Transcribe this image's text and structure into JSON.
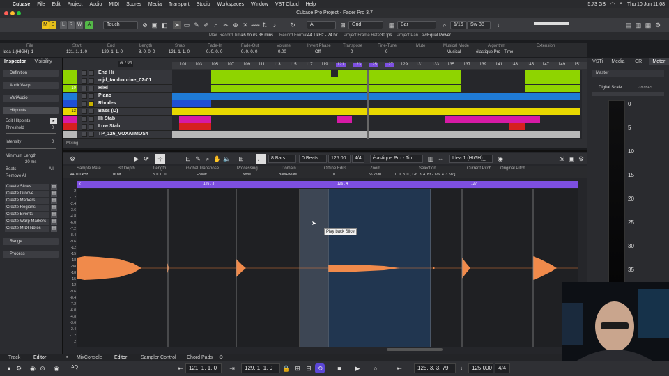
{
  "menubar": {
    "app": "Cubase",
    "items": [
      "File",
      "Edit",
      "Project",
      "Audio",
      "MIDI",
      "Scores",
      "Media",
      "Transport",
      "Studio",
      "Workspaces",
      "Window",
      "VST Cloud",
      "Help"
    ],
    "storage": "5.73 GB",
    "datetime": "Thu 10 Jun  11:08"
  },
  "window": {
    "title": "Cubase Pro Project - Fader Pro 3.7"
  },
  "toolbar": {
    "m": "M",
    "s": "S",
    "l": "L",
    "r": "R",
    "w": "W",
    "a": "A",
    "automation_mode": "Touch",
    "grid_type": "Grid",
    "grid_value": "Bar",
    "quantize": "1/16",
    "swing": "Sw-38",
    "snap_label": "A"
  },
  "status": {
    "max_rec_label": "Max. Record Time",
    "max_rec": "76 hours 36 mins",
    "rec_format_label": "Record Format",
    "rec_format": "44.1 kHz - 24 bit",
    "frame_rate_label": "Project Frame Rate",
    "frame_rate": "30 fps",
    "pan_law_label": "Project Pan Law",
    "pan_law": "Equal Power"
  },
  "infoline": [
    {
      "label": "File",
      "value": "Idea 1 (HIGH)_1"
    },
    {
      "label": "Start",
      "value": "121. 1. 1.  0"
    },
    {
      "label": "End",
      "value": "129. 1. 1.  0"
    },
    {
      "label": "Length",
      "value": "8. 0. 0.  0"
    },
    {
      "label": "Snap",
      "value": "121. 1. 1.  0"
    },
    {
      "label": "Fade-In",
      "value": "0. 0. 0.  0"
    },
    {
      "label": "Fade-Out",
      "value": "0. 0. 0.  0"
    },
    {
      "label": "Volume",
      "value": "0.00"
    },
    {
      "label": "Invert Phase",
      "value": "Off"
    },
    {
      "label": "Transpose",
      "value": "0"
    },
    {
      "label": "Fine-Tune",
      "value": "0"
    },
    {
      "label": "Mute",
      "value": "-"
    },
    {
      "label": "Musical Mode",
      "value": "Musical"
    },
    {
      "label": "Algorithm",
      "value": "élastique Pro - Time"
    },
    {
      "label": "Extension",
      "value": "-"
    }
  ],
  "inspector": {
    "tabs": [
      "Inspector",
      "Visibility"
    ],
    "sections": [
      "Definition",
      "AudioWarp",
      "VariAudio",
      "Hitpoints"
    ],
    "edit_hitpoints": "Edit Hitpoints",
    "threshold_label": "Threshold",
    "threshold_value": "0",
    "intensity_label": "Intensity",
    "intensity_value": "0",
    "min_length_label": "Minimum Length",
    "min_length_value": "20 ms",
    "beats_label": "Beats",
    "beats_value": "All",
    "remove_all": "Remove All",
    "create_buttons": [
      "Create Slices",
      "Create Groove",
      "Create Markers",
      "Create Regions",
      "Create Events",
      "Create Warp Markers",
      "Create MIDI Notes"
    ],
    "range": "Range",
    "process": "Process"
  },
  "arranger": {
    "track_count": "76 / 94",
    "ruler": [
      "101",
      "103",
      "105",
      "107",
      "109",
      "111",
      "113",
      "115",
      "117",
      "119",
      "121",
      "123",
      "125",
      "127",
      "129",
      "131",
      "133",
      "135",
      "137",
      "139",
      "141",
      "143",
      "145",
      "147",
      "149",
      "151"
    ],
    "tracks": [
      {
        "num": "",
        "name": "End Hi",
        "color": "#8fd400"
      },
      {
        "num": "",
        "name": "mjd_tambourine_02-01",
        "color": "#8fd400"
      },
      {
        "num": "10",
        "name": "HiHi",
        "color": "#8fd400"
      },
      {
        "num": "",
        "name": "Piano",
        "color": "#1f7bd6"
      },
      {
        "num": "",
        "name": "Rhodes",
        "color": "#1f4fd6"
      },
      {
        "num": "13",
        "name": "Bass (D)",
        "color": "#e8d800"
      },
      {
        "num": "",
        "name": "Hi Stab",
        "color": "#d61aa6"
      },
      {
        "num": "",
        "name": "Low Stab",
        "color": "#d62020"
      },
      {
        "num": "",
        "name": "TP_126_VOXATMOS4",
        "color": "#b8b8b8"
      }
    ],
    "mixing_label": "Mixing"
  },
  "editor": {
    "bars": "8 Bars",
    "beats": "0 Beats",
    "tempo": "125.00",
    "signature": "4/4",
    "algorithm": "élastique Pro - Tim",
    "file": "Idea 1 (HIGH)_",
    "info": [
      {
        "label": "Sample Rate",
        "value": "44.100  kHz"
      },
      {
        "label": "Bit Depth",
        "value": "16  bit"
      },
      {
        "label": "Length",
        "value": "8. 0. 0.  0"
      },
      {
        "label": "Global Transpose",
        "value": "Follow"
      },
      {
        "label": "Processing",
        "value": "None"
      },
      {
        "label": "Domain",
        "value": "Bars+Beats"
      },
      {
        "label": "Offline Edits",
        "value": "0"
      },
      {
        "label": "Zoom",
        "value": "55.2780"
      },
      {
        "label": "Selection",
        "value": "0. 0. 3. 0  [ 126. 3. 4. 83 - 126. 4. 3. 92 ]"
      },
      {
        "label": "Current Pitch",
        "value": ""
      },
      {
        "label": "Original Pitch",
        "value": ""
      }
    ],
    "sample_ruler": [
      "2",
      "126 . 3",
      "126 . 4",
      "127"
    ],
    "vscale": [
      "2",
      "-1.2",
      "-2.4",
      "-3.6",
      "-4.8",
      "-6.0",
      "-7.2",
      "-8.4",
      "-9.6",
      "-12",
      "-15",
      "-18",
      "-oo",
      "-18",
      "-15",
      "-12",
      "-9.6",
      "-8.4",
      "-7.2",
      "-6.0",
      "-4.8",
      "-3.6",
      "-2.4",
      "-1.2",
      "2"
    ],
    "tooltip": "Play back Slice"
  },
  "rightpanel": {
    "tabs": [
      "VSTi",
      "Media",
      "CR",
      "Meter"
    ],
    "master": "Master",
    "digital_scale": "Digital Scale",
    "scale_value": "-18 dBFS",
    "meter_scale": [
      "0",
      "5",
      "10",
      "15",
      "20",
      "25",
      "30",
      "35"
    ]
  },
  "bottom": {
    "tabs_left": [
      "Track",
      "Editor"
    ],
    "tabs": [
      "MixConsole",
      "Editor",
      "Sampler Control",
      "Chord Pads"
    ]
  },
  "transport": {
    "aq": "AQ",
    "left_locator": "121. 1. 1.  0",
    "right_locator": "129. 1. 1.  0",
    "position": "125. 3. 3. 79",
    "tempo": "125.000",
    "signature": "4/4"
  }
}
